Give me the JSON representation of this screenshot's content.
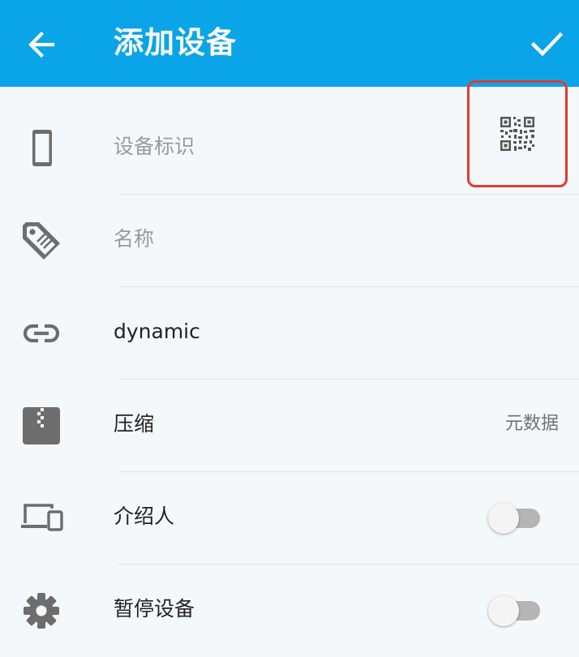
{
  "appbar": {
    "title": "添加设备",
    "back_icon": "arrow-left-icon",
    "confirm_icon": "check-icon",
    "background_color": "#0aa5e8"
  },
  "fields": {
    "device_id": {
      "placeholder": "设备标识",
      "icon": "phone-icon",
      "action_icon": "qr-code-icon"
    },
    "name": {
      "placeholder": "名称",
      "icon": "tag-icon"
    },
    "address": {
      "value": "dynamic",
      "icon": "link-icon"
    },
    "compression": {
      "label": "压缩",
      "value": "元数据",
      "icon": "archive-icon"
    },
    "introducer": {
      "label": "介绍人",
      "icon": "devices-icon",
      "enabled": false
    },
    "paused": {
      "label": "暂停设备",
      "icon": "gear-icon",
      "enabled": false
    }
  },
  "colors": {
    "highlight_border": "#e23a32",
    "icon_gray": "#6d6d6d"
  }
}
